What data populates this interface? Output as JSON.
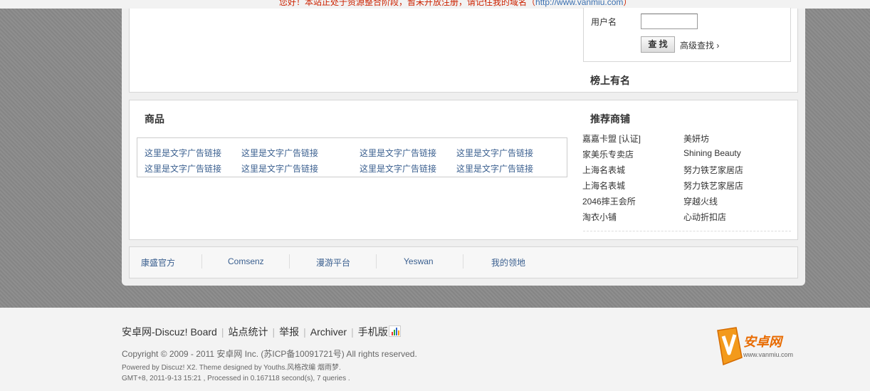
{
  "notice": {
    "text": "您好！本站正处于资源整合阶段，暂未开放注册，请记住我的域名（",
    "url": "http://www.vanmiu.com",
    "suffix": "）"
  },
  "search": {
    "username_label": "用户名",
    "username_value": "",
    "search_button": "查 找",
    "advanced_link": "高级查找 ›"
  },
  "sections": {
    "bang_title": "榜上有名",
    "goods_title": "商品",
    "shops_title": "推荐商铺"
  },
  "ads": [
    "这里是文字广告链接",
    "这里是文字广告链接",
    "这里是文字广告链接",
    "这里是文字广告链接",
    "这里是文字广告链接",
    "这里是文字广告链接",
    "这里是文字广告链接",
    "这里是文字广告链接"
  ],
  "shops": [
    "嘉嘉卡盟 [认证]",
    "美妍坊",
    "家美乐专卖店",
    "Shining Beauty",
    "上海名表城",
    "努力铁艺家居店",
    "上海名表城",
    "努力铁艺家居店",
    "2046摔王会所",
    "穿越火线",
    "淘衣小铺",
    "心动折扣店"
  ],
  "friend_links": [
    "康盛官方",
    "Comsenz",
    "漫游平台",
    "Yeswan",
    "我的领地"
  ],
  "footer": {
    "nav": [
      "安卓网-Discuz! Board",
      "站点统计",
      "举报",
      "Archiver",
      "手机版"
    ],
    "copyright": "Copyright © 2009 - 2011 安卓网 Inc. (苏ICP备10091721号) All rights reserved.",
    "powered": "Powered by Discuz! X2. Theme designed by Youths.风格改编 烟雨梦.",
    "gmt": "GMT+8, 2011-9-13 15:21 , Processed in 0.167118 second(s), 7 queries ."
  },
  "logo": {
    "name": "安卓网",
    "url": "www.vanmiu.com"
  },
  "colors": {
    "link": "#3a5f8f",
    "notice": "#cc2200",
    "logo_orange": "#e86b00"
  }
}
